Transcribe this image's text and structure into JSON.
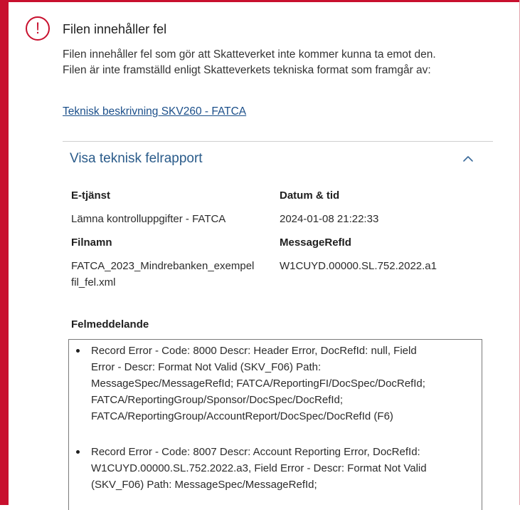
{
  "colors": {
    "alert": "#c8102e",
    "link": "#1b4f8a",
    "toggle": "#2a5b8a"
  },
  "icons": {
    "alert": "exclamation-circle-icon",
    "toggle": "chevron-up-icon"
  },
  "alert": {
    "icon_glyph": "!",
    "title": "Filen innehåller fel",
    "description_lines": [
      "Filen innehåller fel som gör att Skatteverket inte kommer kunna ta emot den.",
      "Filen är inte framställd enligt Skatteverkets tekniska format som framgår av:"
    ],
    "link": "Teknisk beskrivning SKV260 - FATCA"
  },
  "report": {
    "toggle_label": "Visa teknisk felrapport",
    "expanded": true,
    "fields": {
      "service": {
        "label": "E-tjänst",
        "value": "Lämna kontrolluppgifter - FATCA"
      },
      "datetime": {
        "label": "Datum & tid",
        "value": "2024-01-08 21:22:33"
      },
      "filename": {
        "label": "Filnamn",
        "value_lines": [
          "FATCA_2023_Mindrebanken_exempel",
          "fil_fel.xml"
        ]
      },
      "message_ref": {
        "label": "MessageRefId",
        "value": "W1CUYD.00000.SL.752.2022.a1"
      }
    },
    "messages_heading": "Felmeddelande",
    "messages": [
      {
        "lines": [
          "Record Error - Code: 8000 Descr: Header Error, DocRefId: null, Field",
          "Error - Descr: Format Not Valid (SKV_F06) Path:",
          "MessageSpec/MessageRefId; FATCA/ReportingFI/DocSpec/DocRefId;",
          "FATCA/ReportingGroup/Sponsor/DocSpec/DocRefId;",
          "FATCA/ReportingGroup/AccountReport/DocSpec/DocRefId (F6)"
        ]
      },
      {
        "lines": [
          "Record Error - Code: 8007 Descr: Account Reporting Error, DocRefId:",
          "W1CUYD.00000.SL.752.2022.a3, Field Error - Descr: Format Not Valid",
          "(SKV_F06) Path: MessageSpec/MessageRefId;"
        ]
      }
    ]
  }
}
